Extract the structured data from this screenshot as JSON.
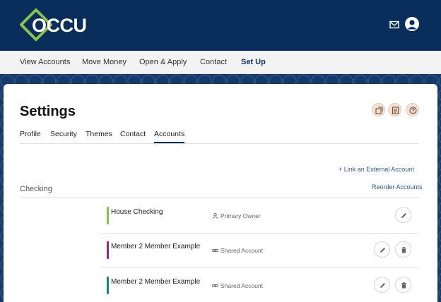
{
  "brand": {
    "logo_text": "OCCU",
    "accent": "#8bc34a",
    "primary": "#0a2e5c"
  },
  "header": {
    "mail_icon": "mail-icon",
    "avatar_icon": "user-avatar-icon"
  },
  "nav": {
    "items": [
      {
        "label": "View Accounts",
        "active": false
      },
      {
        "label": "Move Money",
        "active": false
      },
      {
        "label": "Open & Apply",
        "active": false
      },
      {
        "label": "Contact",
        "active": false
      },
      {
        "label": "Set Up",
        "active": true
      }
    ]
  },
  "settings": {
    "title": "Settings",
    "toolbar_icons": [
      "export-icon",
      "print-icon",
      "help-icon"
    ],
    "tabs": [
      {
        "label": "Profile",
        "active": false
      },
      {
        "label": "Security",
        "active": false
      },
      {
        "label": "Themes",
        "active": false
      },
      {
        "label": "Contact",
        "active": false
      },
      {
        "label": "Accounts",
        "active": true
      }
    ],
    "link_external": "+ Link an External Account",
    "section": {
      "label": "Checking",
      "reorder": "Reorder Accounts"
    },
    "accounts": [
      {
        "name": "House Checking",
        "role": "Primary Owner",
        "color": "#8bc34a",
        "can_delete": false
      },
      {
        "name": "Member 2 Member Example",
        "role": "Shared Account",
        "color": "#8e2b8e",
        "can_delete": true
      },
      {
        "name": "Member 2 Member Example",
        "role": "Shared Account",
        "color": "#16857c",
        "can_delete": true
      }
    ]
  }
}
